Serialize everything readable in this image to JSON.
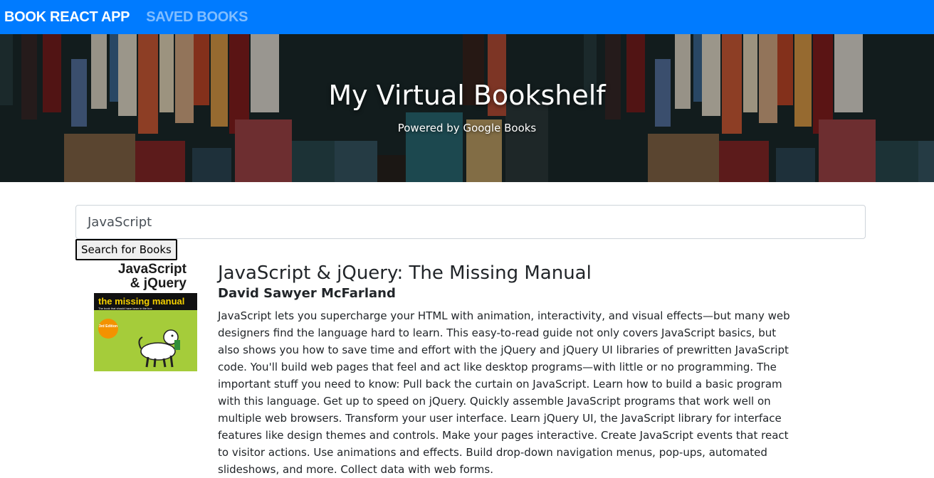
{
  "nav": {
    "brand": "BOOK REACT APP",
    "saved_link": "SAVED BOOKS"
  },
  "hero": {
    "title": "My Virtual Bookshelf",
    "subtitle": "Powered by Google Books"
  },
  "search": {
    "value": "JavaScript",
    "button_label": "Search for Books"
  },
  "results": [
    {
      "title": "JavaScript & jQuery: The Missing Manual",
      "author": "David Sawyer McFarland",
      "description": "JavaScript lets you supercharge your HTML with animation, interactivity, and visual effects—but many web designers find the language hard to learn. This easy-to-read guide not only covers JavaScript basics, but also shows you how to save time and effort with the jQuery and jQuery UI libraries of prewritten JavaScript code. You'll build web pages that feel and act like desktop programs—with little or no programming. The important stuff you need to know: Pull back the curtain on JavaScript. Learn how to build a basic program with this language. Get up to speed on jQuery. Quickly assemble JavaScript programs that work well on multiple web browsers. Transform your user interface. Learn jQuery UI, the JavaScript library for interface features like design themes and controls. Make your pages interactive. Create JavaScript events that react to visitor actions. Use animations and effects. Build drop-down navigation menus, pop-ups, automated slideshows, and more. Collect data with web forms.",
      "cover": {
        "line1": "JavaScript",
        "line2": "& jQuery",
        "banner": "the missing manual",
        "tagline": "The book that should have been in the box",
        "edition": "3rd Edition"
      }
    }
  ],
  "colors": {
    "navbar": "#007bff",
    "cover_green": "#a5cc3a",
    "cover_badge": "#f39200"
  }
}
